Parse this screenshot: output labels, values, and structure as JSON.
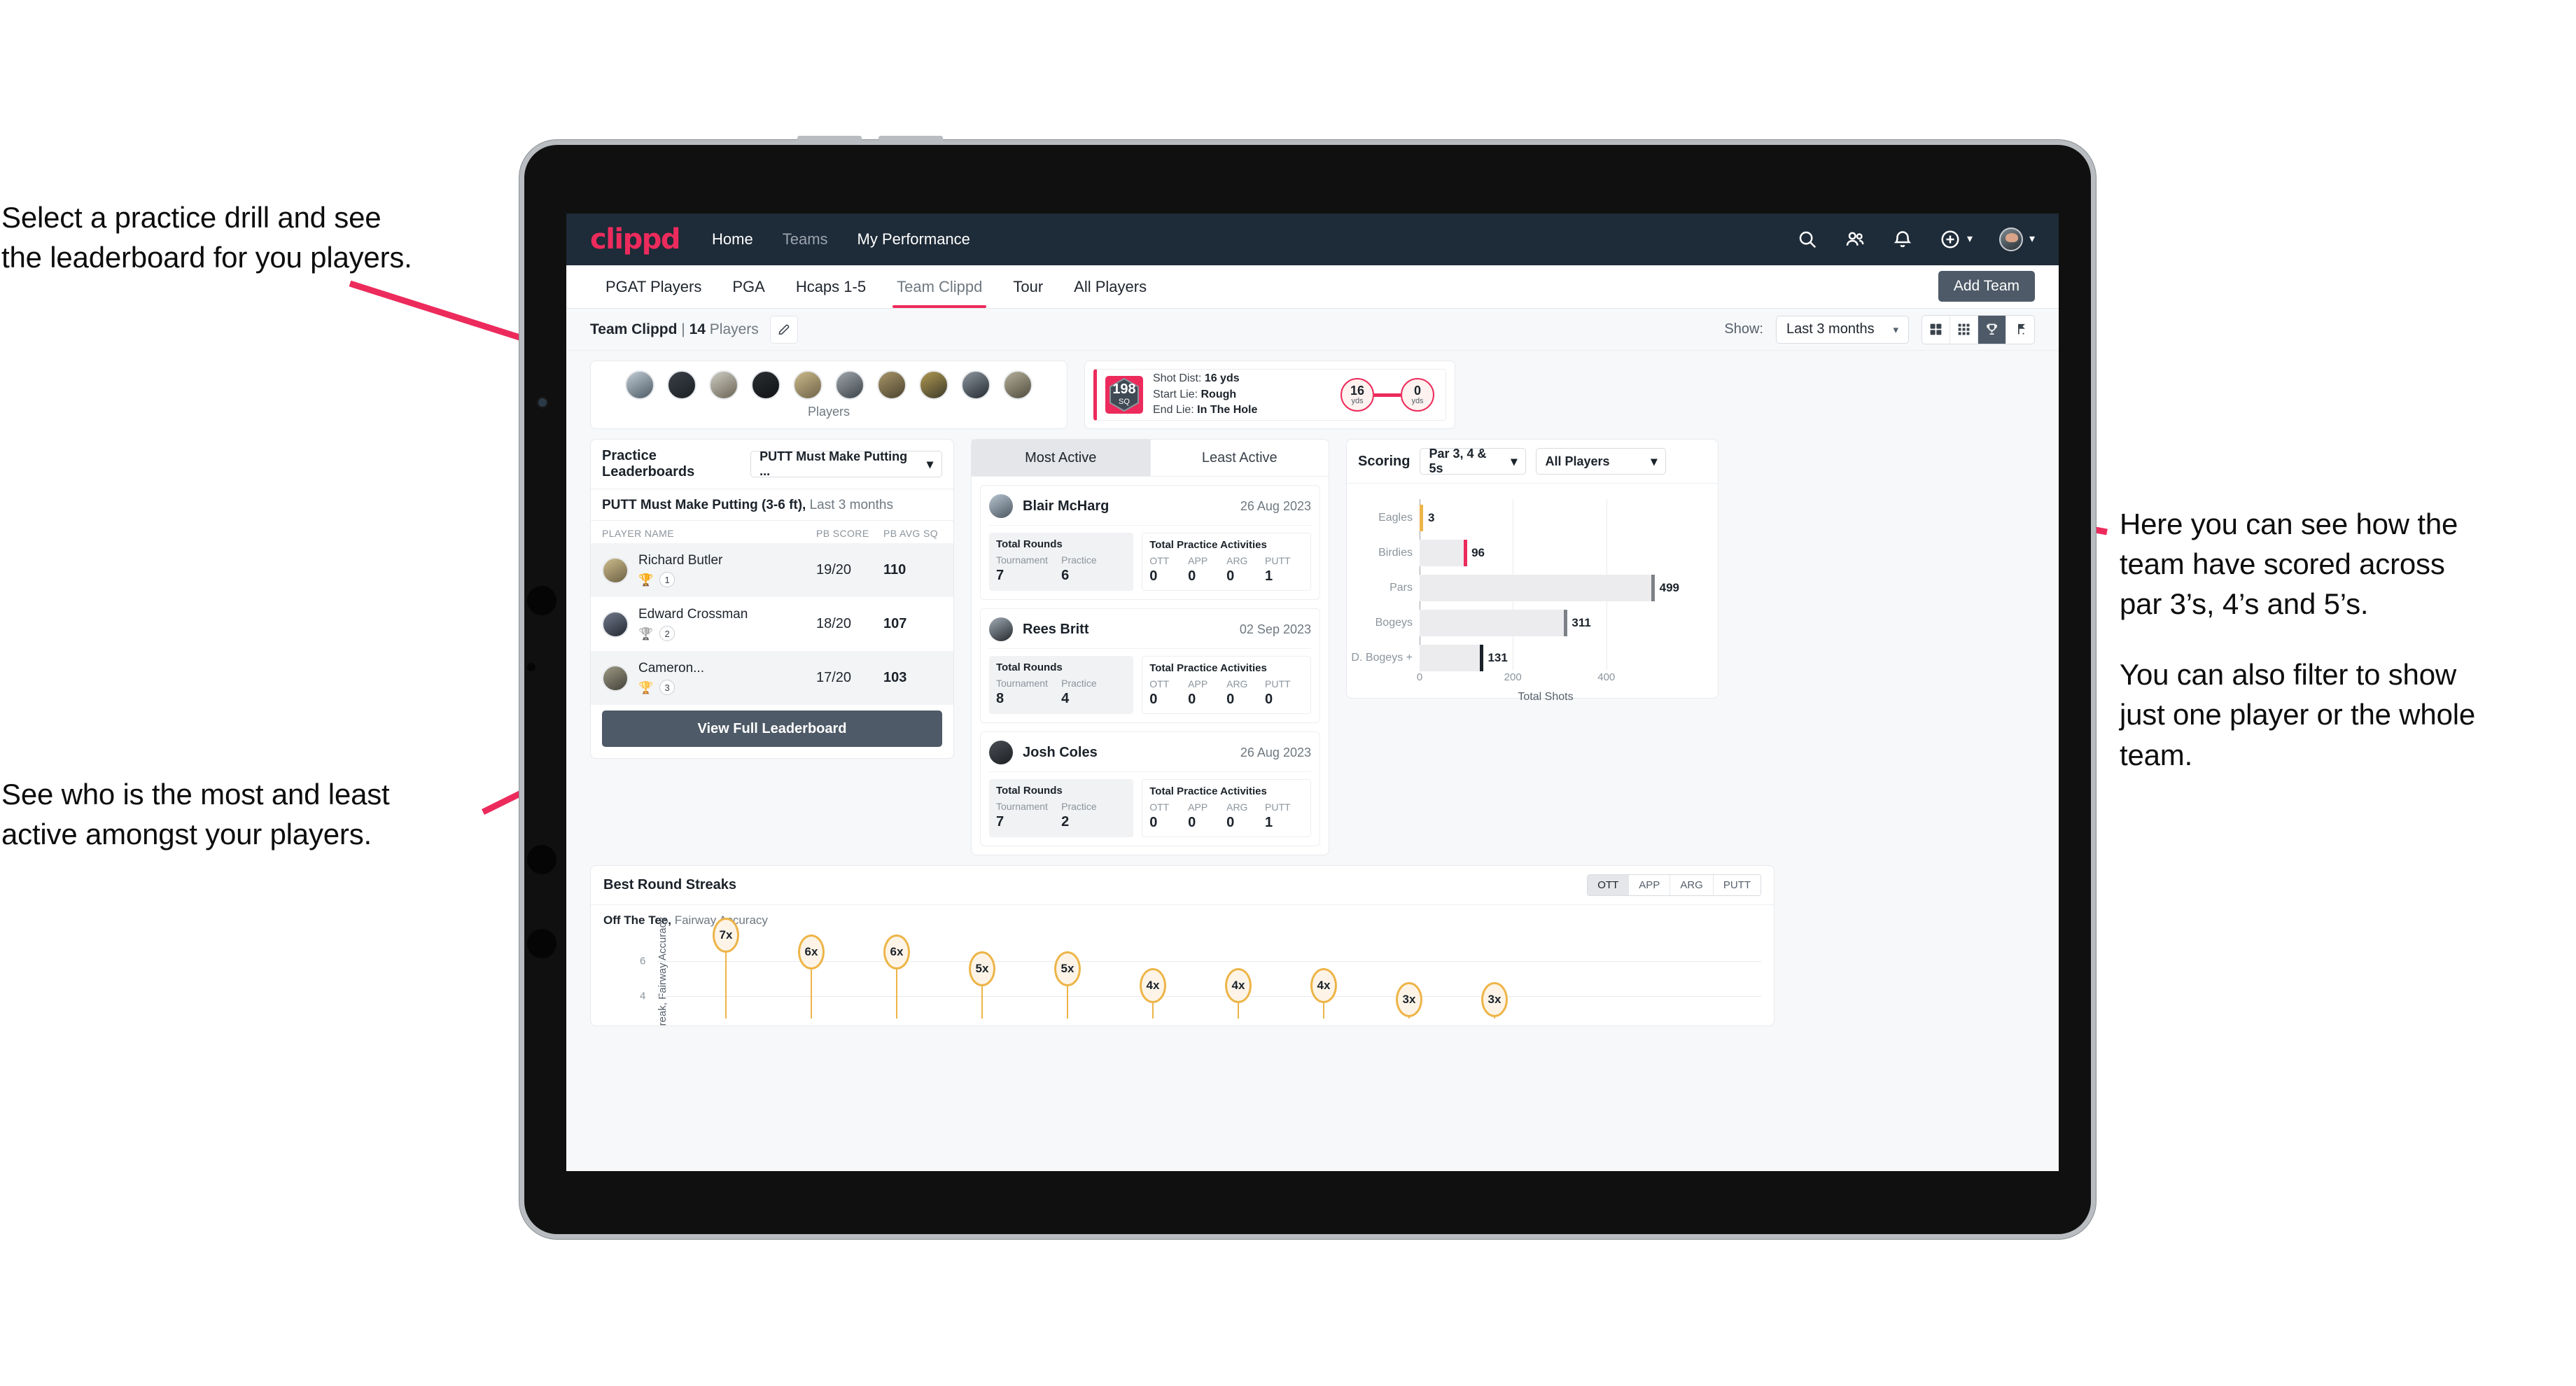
{
  "annotations": {
    "top_left": [
      "Select a practice drill and see",
      "the leaderboard for you players."
    ],
    "bottom_left": [
      "See who is the most and least",
      "active amongst your players."
    ],
    "right_p1": [
      "Here you can see how the",
      "team have scored across",
      "par 3’s, 4’s and 5’s."
    ],
    "right_p2": [
      "You can also filter to show",
      "just one player or the whole",
      "team."
    ]
  },
  "navbar": {
    "logo": "clippd",
    "links": [
      {
        "label": "Home",
        "active": true
      },
      {
        "label": "Teams",
        "active": false
      },
      {
        "label": "My Performance",
        "active": true
      }
    ],
    "icons": [
      "search-icon",
      "people-icon",
      "bell-icon",
      "plus-circle-icon",
      "avatar"
    ]
  },
  "tabs": {
    "items": [
      "PGAT Players",
      "PGA",
      "Hcaps 1-5",
      "Team Clippd",
      "Tour",
      "All Players"
    ],
    "active": "Team Clippd",
    "add_team_label": "Add Team"
  },
  "subbar": {
    "team_name": "Team Clippd",
    "separator": " | ",
    "player_count": "14",
    "players_word": "Players",
    "show_label": "Show:",
    "range_value": "Last 3 months",
    "view_buttons": [
      "grid-large-icon",
      "grid-small-icon",
      "trophy-icon",
      "golf-flag-icon"
    ],
    "view_active_index": 2
  },
  "players_card": {
    "caption": "Players",
    "avatar_count": 10
  },
  "shot_card": {
    "sq_value": "198",
    "sq_unit": "SQ",
    "lines": [
      {
        "label": "Shot Dist:",
        "value": "16 yds"
      },
      {
        "label": "Start Lie:",
        "value": "Rough"
      },
      {
        "label": "End Lie:",
        "value": "In The Hole"
      }
    ],
    "start_dist": "16",
    "start_unit": "yds",
    "end_dist": "0",
    "end_unit": "yds"
  },
  "leaderboard": {
    "title": "Practice Leaderboards",
    "drill_selected": "PUTT Must Make Putting ...",
    "subtitle_bold": "PUTT Must Make Putting (3-6 ft),",
    "subtitle_rest": " Last 3 months",
    "columns": [
      "PLAYER NAME",
      "PB SCORE",
      "PB AVG SQ"
    ],
    "rows": [
      {
        "name": "Richard Butler",
        "trophy": "gold",
        "rank": "1",
        "score": "19/20",
        "avg": "110"
      },
      {
        "name": "Edward Crossman",
        "trophy": "silver",
        "rank": "2",
        "score": "18/20",
        "avg": "107"
      },
      {
        "name": "Cameron...",
        "trophy": "bronze",
        "rank": "3",
        "score": "17/20",
        "avg": "103"
      }
    ],
    "button_label": "View Full Leaderboard"
  },
  "activity": {
    "tabs": [
      "Most Active",
      "Least Active"
    ],
    "active_tab": "Most Active",
    "rounds_title": "Total Rounds",
    "rounds_keys": [
      "Tournament",
      "Practice"
    ],
    "acts_title": "Total Practice Activities",
    "acts_keys": [
      "OTT",
      "APP",
      "ARG",
      "PUTT"
    ],
    "items": [
      {
        "name": "Blair McHarg",
        "date": "26 Aug 2023",
        "rounds": [
          "7",
          "6"
        ],
        "acts": [
          "0",
          "0",
          "0",
          "1"
        ]
      },
      {
        "name": "Rees Britt",
        "date": "02 Sep 2023",
        "rounds": [
          "8",
          "4"
        ],
        "acts": [
          "0",
          "0",
          "0",
          "0"
        ]
      },
      {
        "name": "Josh Coles",
        "date": "26 Aug 2023",
        "rounds": [
          "7",
          "2"
        ],
        "acts": [
          "0",
          "0",
          "0",
          "1"
        ]
      }
    ]
  },
  "scoring": {
    "title": "Scoring",
    "par_filter": "Par 3, 4 & 5s",
    "player_filter": "All Players"
  },
  "streaks": {
    "title": "Best Round Streaks",
    "seg": [
      "OTT",
      "APP",
      "ARG",
      "PUTT"
    ],
    "seg_active": "OTT",
    "sub_bold": "Off The Tee,",
    "sub_rest": " Fairway Accuracy",
    "ylabel": "Streak, Fairway Accuracy"
  },
  "chart_data": [
    {
      "type": "bar",
      "orientation": "horizontal",
      "title": "Scoring",
      "categories": [
        "Eagles",
        "Birdies",
        "Pars",
        "Bogeys",
        "D. Bogeys +"
      ],
      "values": [
        3,
        96,
        499,
        311,
        131
      ],
      "cap_colors": [
        "#edb447",
        "#ec2b5c",
        "#7d8187",
        "#7d8187",
        "#1b222a"
      ],
      "xlabel": "Total Shots",
      "ylabel": "",
      "xlim": [
        0,
        540
      ],
      "xticks": [
        0,
        200,
        400
      ],
      "grid": true,
      "legend": "none"
    },
    {
      "type": "bar",
      "variant": "lollipop",
      "title": "Best Round Streaks",
      "subtitle": "Off The Tee, Fairway Accuracy",
      "categories": [
        "1",
        "2",
        "3",
        "4",
        "5",
        "6",
        "7",
        "8",
        "9",
        "10"
      ],
      "values": [
        7,
        6,
        6,
        5,
        5,
        4,
        4,
        4,
        3,
        3
      ],
      "labels": [
        "7x",
        "6x",
        "6x",
        "5x",
        "5x",
        "4x",
        "4x",
        "4x",
        "3x",
        "3x"
      ],
      "ylabel": "Streak, Fairway Accuracy",
      "xlabel": "",
      "ylim": [
        0,
        8
      ],
      "yticks": [
        4,
        6
      ],
      "grid": true,
      "legend": "none"
    }
  ]
}
